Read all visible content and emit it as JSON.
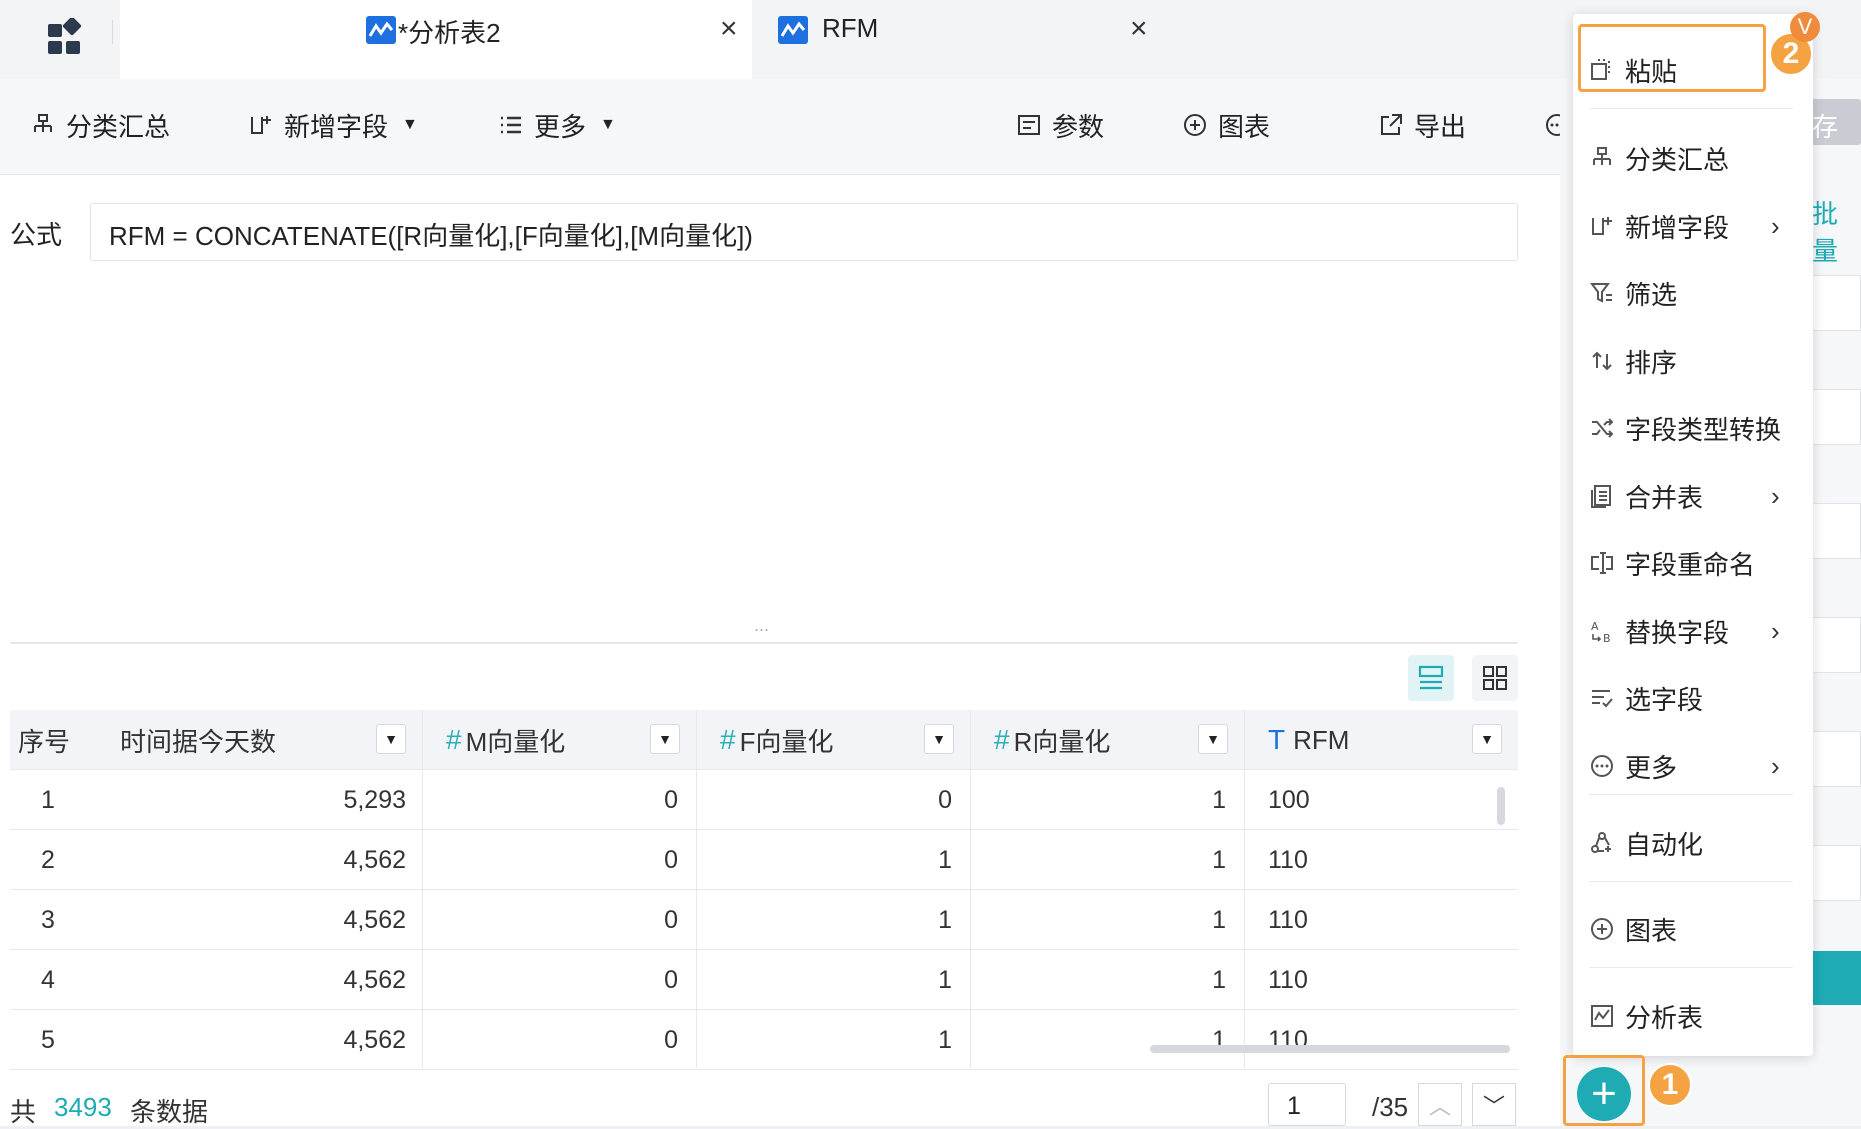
{
  "tabs": [
    {
      "title": "*分析表2",
      "close": "×"
    },
    {
      "title": "RFM",
      "close": "×"
    }
  ],
  "toolbar": {
    "group_summary": "分类汇总",
    "add_field": "新增字段",
    "more": "更多",
    "params": "参数",
    "chart": "图表",
    "export": "导出",
    "right_partial_1": "存",
    "right_partial_2": "批量"
  },
  "formula": {
    "label": "公式",
    "text": "RFM = CONCATENATE([R向量化],[F向量化],[M向量化])",
    "drag_handle": "..."
  },
  "table": {
    "columns": [
      {
        "label": "序号",
        "type": ""
      },
      {
        "label": "时间据今天数",
        "type": ""
      },
      {
        "label": "M向量化",
        "type": "#"
      },
      {
        "label": "F向量化",
        "type": "#"
      },
      {
        "label": "R向量化",
        "type": "#"
      },
      {
        "label": "RFM",
        "type": "T"
      }
    ],
    "rows": [
      [
        "1",
        "5,293",
        "0",
        "0",
        "1",
        "100"
      ],
      [
        "2",
        "4,562",
        "0",
        "1",
        "1",
        "110"
      ],
      [
        "3",
        "4,562",
        "0",
        "1",
        "1",
        "110"
      ],
      [
        "4",
        "4,562",
        "0",
        "1",
        "1",
        "110"
      ],
      [
        "5",
        "4,562",
        "0",
        "1",
        "1",
        "110"
      ]
    ]
  },
  "footer": {
    "prefix": "共",
    "count": "3493",
    "suffix": "条数据",
    "page": "1",
    "total_pages": "/35"
  },
  "menu": {
    "items": [
      {
        "label": "粘贴",
        "icon": "paste-icon",
        "submenu": false
      },
      {
        "label": "分类汇总",
        "icon": "group-summary-icon",
        "submenu": false
      },
      {
        "label": "新增字段",
        "icon": "add-field-icon",
        "submenu": true
      },
      {
        "label": "筛选",
        "icon": "filter-icon",
        "submenu": false
      },
      {
        "label": "排序",
        "icon": "sort-icon",
        "submenu": false
      },
      {
        "label": "字段类型转换",
        "icon": "convert-icon",
        "submenu": false
      },
      {
        "label": "合并表",
        "icon": "merge-icon",
        "submenu": true
      },
      {
        "label": "字段重命名",
        "icon": "rename-icon",
        "submenu": false
      },
      {
        "label": "替换字段",
        "icon": "replace-icon",
        "submenu": true
      },
      {
        "label": "选字段",
        "icon": "select-field-icon",
        "submenu": false
      },
      {
        "label": "更多",
        "icon": "more-icon",
        "submenu": true
      },
      {
        "label": "自动化",
        "icon": "automation-icon",
        "submenu": false
      },
      {
        "label": "图表",
        "icon": "chart-icon",
        "submenu": false
      },
      {
        "label": "分析表",
        "icon": "analysis-icon",
        "submenu": false
      }
    ]
  },
  "annotations": {
    "step1": "1",
    "step2": "2",
    "avatar_initial": "V"
  },
  "colors": {
    "accent": "#1eabb4",
    "highlight": "#f5a342",
    "link": "#1e6fe0"
  }
}
